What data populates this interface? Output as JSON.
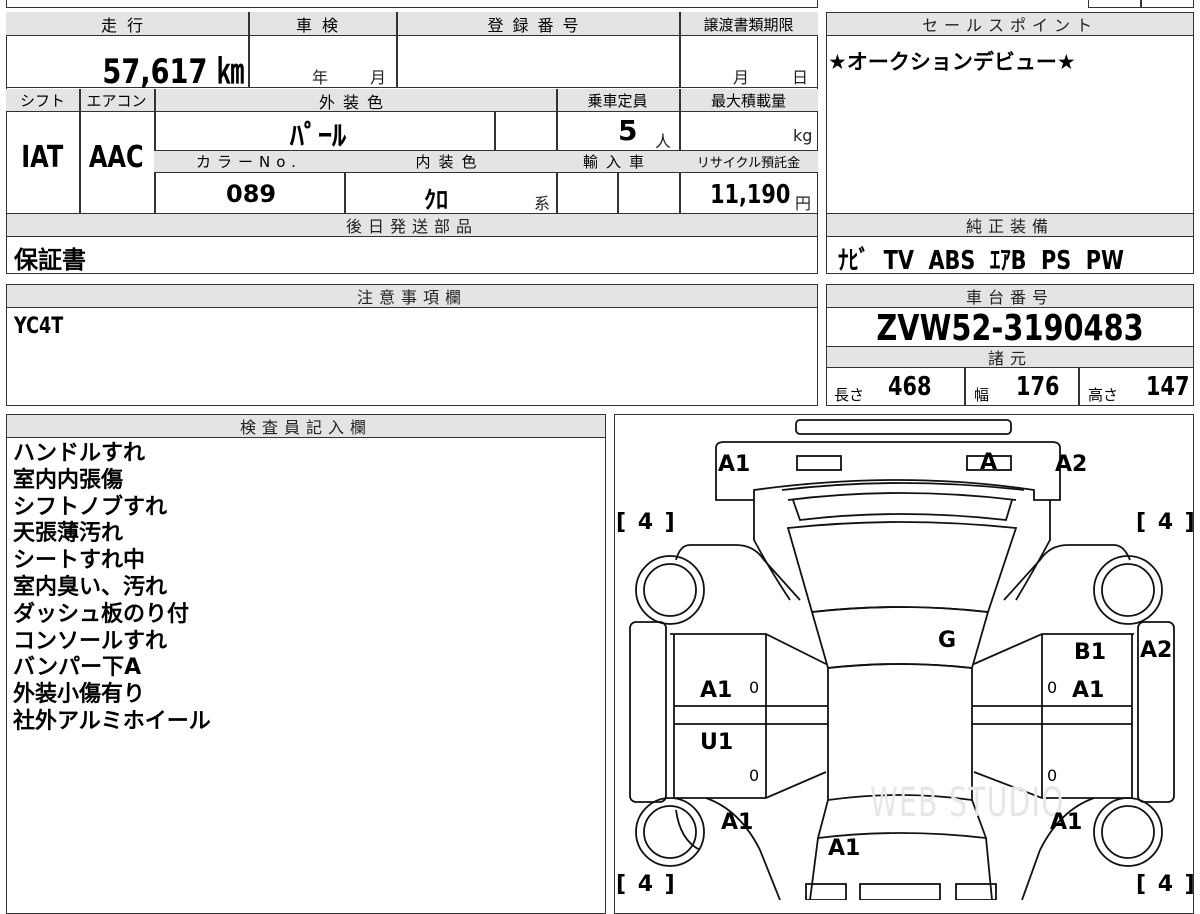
{
  "top_left_fields": {
    "mileage_label": "走行",
    "mileage_value": "57,617 ㎞",
    "inspection_label": "車検",
    "inspection_year_unit": "年",
    "inspection_month_unit": "月",
    "registration_label": "登録番号",
    "transfer_deadline_label": "譲渡書類期限",
    "transfer_month_unit": "月",
    "transfer_day_unit": "日",
    "shift_label": "シフト",
    "shift_value": "IAT",
    "aircon_label": "エアコン",
    "aircon_value": "AAC",
    "exterior_color_label": "外装色",
    "exterior_color_value": "ﾊﾟｰﾙ",
    "capacity_label": "乗車定員",
    "capacity_value": "5",
    "capacity_unit": "人",
    "max_load_label": "最大積載量",
    "max_load_unit": "kg",
    "color_no_label": "カラーNo.",
    "color_no_value": "089",
    "interior_color_label": "内装色",
    "interior_color_value": "ｸﾛ",
    "interior_color_suffix": "系",
    "import_label": "輸入車",
    "recycle_label": "リサイクル預託金",
    "recycle_value": "11,190",
    "recycle_unit": "円"
  },
  "sales_points": {
    "header": "セールスポイント",
    "text": "★オークションデビュー★"
  },
  "later_parts": {
    "header": "後日発送部品",
    "text": "保証書"
  },
  "genuine_equipment": {
    "header": "純正装備",
    "text": "ﾅﾋﾞ  TV  ABS  ｴｱB  PS  PW"
  },
  "notes": {
    "header": "注意事項欄",
    "text": "YC4T"
  },
  "chassis": {
    "header": "車台番号",
    "value": "ZVW52-3190483"
  },
  "specs": {
    "header": "諸元",
    "length_label": "長さ",
    "length_value": "468",
    "width_label": "幅",
    "width_value": "176",
    "height_label": "高さ",
    "height_value": "147"
  },
  "inspector": {
    "header": "検査員記入欄",
    "lines": [
      "ハンドルすれ",
      "室内内張傷",
      "シフトノブすれ",
      "天張薄汚れ",
      "シートすれ中",
      "室内臭い、汚れ",
      "ダッシュ板のり付",
      "コンソールすれ",
      "バンパー下A",
      "外装小傷有り",
      "社外アルミホイール"
    ]
  },
  "diagram": {
    "damage_marks": {
      "front_left": "A1",
      "front_center": "A",
      "front_right": "A2",
      "roof": "G",
      "left_front_door": "A1",
      "left_rear_door": "U1",
      "right_upper": "B1",
      "right_front_door": "A1",
      "right_side": "A2",
      "left_rear_fender": "A1",
      "right_rear_fender": "A1",
      "trunk": "A1"
    },
    "tire_tread": {
      "front_left": "[ 4 ]",
      "front_right": "[ 4 ]",
      "rear_left": "[ 4 ]",
      "rear_right": "[ 4 ]"
    },
    "door_zero": "0",
    "watermark": "WEB STUDIO"
  }
}
